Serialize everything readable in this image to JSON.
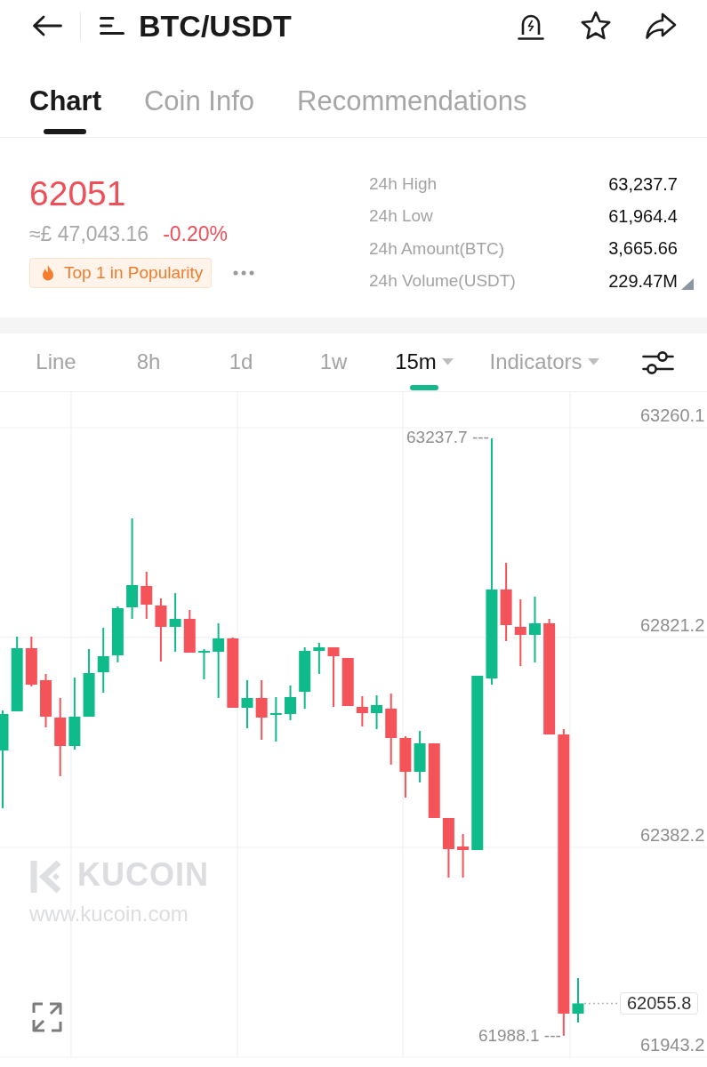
{
  "header": {
    "title": "BTC/USDT"
  },
  "tabs": [
    {
      "label": "Chart",
      "selected": true
    },
    {
      "label": "Coin Info",
      "selected": false
    },
    {
      "label": "Recommendations",
      "selected": false
    }
  ],
  "ticker": {
    "price": "62051",
    "fiat_price": "≈£ 47,043.16",
    "change": "-0.20%",
    "badge": "Top 1 in Popularity"
  },
  "stats": [
    {
      "label": "24h High",
      "value": "63,237.7",
      "expandable": false
    },
    {
      "label": "24h Low",
      "value": "61,964.4",
      "expandable": false
    },
    {
      "label": "24h Amount(BTC)",
      "value": "3,665.66",
      "expandable": false
    },
    {
      "label": "24h Volume(USDT)",
      "value": "229.47M",
      "expandable": true
    }
  ],
  "intervals": [
    {
      "label": "Line",
      "selected": false,
      "has_menu": false
    },
    {
      "label": "8h",
      "selected": false,
      "has_menu": false
    },
    {
      "label": "1d",
      "selected": false,
      "has_menu": false
    },
    {
      "label": "1w",
      "selected": false,
      "has_menu": false
    },
    {
      "label": "15m",
      "selected": true,
      "has_menu": true
    },
    {
      "label": "Indicators",
      "selected": false,
      "has_menu": true
    }
  ],
  "chart": {
    "chart_data": {
      "type": "candlestick",
      "ohlc": [
        [
          62584.9,
          62668.6,
          62464.0,
          62661.2
        ],
        [
          62666.8,
          62823.0,
          62666.8,
          62798.8
        ],
        [
          62798.8,
          62823.0,
          62718.8,
          62722.6
        ],
        [
          62731.9,
          62744.9,
          62633.3,
          62655.6
        ],
        [
          62653.7,
          62694.7,
          62531.0,
          62594.2
        ],
        [
          62594.2,
          62737.4,
          62586.8,
          62655.6
        ],
        [
          62655.6,
          62797.0,
          62655.6,
          62746.7
        ],
        [
          62748.6,
          62841.6,
          62705.8,
          62782.1
        ],
        [
          62783.9,
          62886.2,
          62769.1,
          62882.5
        ],
        [
          62884.4,
          63070.4,
          62860.2,
          62930.9
        ],
        [
          62929.0,
          62958.8,
          62860.2,
          62890.0
        ],
        [
          62888.1,
          62903.0,
          62770.9,
          62843.5
        ],
        [
          62843.5,
          62914.1,
          62791.4,
          62860.2
        ],
        [
          62860.2,
          62878.8,
          62789.5,
          62789.5
        ],
        [
          62789.5,
          62797.0,
          62733.7,
          62793.2
        ],
        [
          62791.4,
          62850.9,
          62694.7,
          62819.3
        ],
        [
          62819.3,
          62821.1,
          62674.2,
          62674.2
        ],
        [
          62674.2,
          62731.9,
          62631.4,
          62694.7
        ],
        [
          62694.7,
          62731.9,
          62607.2,
          62653.7
        ],
        [
          62659.3,
          62696.5,
          62603.5,
          62663.0
        ],
        [
          62661.2,
          62720.7,
          62648.2,
          62696.5
        ],
        [
          62707.7,
          62800.7,
          62672.3,
          62793.2
        ],
        [
          62793.2,
          62810.0,
          62744.9,
          62800.7
        ],
        [
          62800.7,
          62800.7,
          62676.1,
          62782.1
        ],
        [
          62778.4,
          62778.4,
          62677.9,
          62677.9
        ],
        [
          62676.1,
          62698.4,
          62635.1,
          62663.0
        ],
        [
          62663.0,
          62700.2,
          62629.6,
          62679.8
        ],
        [
          62672.3,
          62704.0,
          62555.2,
          62611.0
        ],
        [
          62611.0,
          62614.7,
          62486.3,
          62540.3
        ],
        [
          62540.3,
          62625.8,
          62518.0,
          62599.8
        ],
        [
          62599.8,
          62599.8,
          62443.6,
          62443.6
        ],
        [
          62443.6,
          62443.6,
          62318.9,
          62378.5
        ],
        [
          62384.0,
          62410.1,
          62318.9,
          62376.6
        ],
        [
          62376.6,
          62741.2,
          62376.6,
          62741.2
        ],
        [
          62735.6,
          63237.7,
          62722.6,
          62921.6
        ],
        [
          62921.6,
          62977.4,
          62813.7,
          62847.2
        ],
        [
          62843.5,
          62901.1,
          62761.6,
          62826.7
        ],
        [
          62826.7,
          62906.7,
          62769.1,
          62850.9
        ],
        [
          62850.9,
          62860.2,
          62618.4,
          62618.4
        ],
        [
          62618.4,
          62629.6,
          61988.1,
          62034.4
        ],
        [
          62034.4,
          62108.8,
          62015.8,
          62055.8
        ]
      ],
      "ylim": [
        61943.2,
        63260.1
      ],
      "yticks": [
        63260.1,
        62821.2,
        62382.2,
        61943.2
      ],
      "grid": true
    },
    "high_marker": "63237.7 ---",
    "low_marker": "61988.1 ---",
    "last_price": "62055.8",
    "watermark": {
      "brand": "KUCOIN",
      "url": "www.kucoin.com"
    }
  }
}
